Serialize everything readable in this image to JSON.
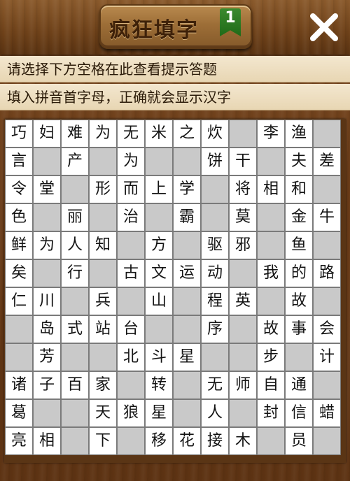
{
  "header": {
    "title": "疯狂填字",
    "level": "1"
  },
  "hints": {
    "line1": "请选择下方空格在此查看提示答题",
    "line2": "填入拼音首字母，正确就会显示汉字"
  },
  "close_icon": "close-icon",
  "grid": {
    "rows": [
      [
        "巧",
        "妇",
        "难",
        "为",
        "无",
        "米",
        "之",
        "炊",
        null,
        "李",
        "渔",
        null
      ],
      [
        "言",
        "",
        "产",
        "",
        "为",
        "",
        "",
        "饼",
        "干",
        "",
        "夫",
        "差"
      ],
      [
        "令",
        "堂",
        "",
        "形",
        "而",
        "上",
        "学",
        "",
        "将",
        "相",
        "和",
        ""
      ],
      [
        "色",
        "",
        "丽",
        "",
        "治",
        "",
        "霸",
        "",
        "莫",
        "",
        "金",
        "牛"
      ],
      [
        "鲜",
        "为",
        "人",
        "知",
        "",
        "方",
        "",
        "驱",
        "邪",
        "",
        "鱼",
        ""
      ],
      [
        "矣",
        "",
        "行",
        "",
        "古",
        "文",
        "运",
        "动",
        "",
        "我",
        "的",
        "路"
      ],
      [
        "仁",
        "川",
        "",
        "兵",
        "",
        "山",
        "",
        "程",
        "英",
        "",
        "故",
        ""
      ],
      [
        null,
        "岛",
        "式",
        "站",
        "台",
        "",
        "",
        "序",
        "",
        "故",
        "事",
        "会"
      ],
      [
        null,
        "芳",
        "",
        "",
        "北",
        "斗",
        "星",
        "",
        "",
        "步",
        "",
        "计"
      ],
      [
        "诸",
        "子",
        "百",
        "家",
        "",
        "转",
        "",
        "无",
        "师",
        "自",
        "通",
        ""
      ],
      [
        "葛",
        "",
        "",
        "天",
        "狼",
        "星",
        "",
        "人",
        "",
        "封",
        "信",
        "蜡"
      ],
      [
        "亮",
        "相",
        "",
        "下",
        "",
        "移",
        "花",
        "接",
        "木",
        "",
        "员",
        ""
      ]
    ],
    "cell_types": [
      [
        "w",
        "w",
        "w",
        "w",
        "w",
        "w",
        "w",
        "w",
        "g",
        "w",
        "w",
        "g"
      ],
      [
        "w",
        "g",
        "w",
        "g",
        "w",
        "g",
        "g",
        "w",
        "w",
        "g",
        "w",
        "w"
      ],
      [
        "w",
        "w",
        "g",
        "w",
        "w",
        "w",
        "w",
        "g",
        "w",
        "w",
        "w",
        "g"
      ],
      [
        "w",
        "g",
        "w",
        "g",
        "w",
        "g",
        "w",
        "g",
        "w",
        "g",
        "w",
        "w"
      ],
      [
        "w",
        "w",
        "w",
        "w",
        "g",
        "w",
        "g",
        "w",
        "w",
        "g",
        "w",
        "g"
      ],
      [
        "w",
        "g",
        "w",
        "g",
        "w",
        "w",
        "w",
        "w",
        "g",
        "w",
        "w",
        "w"
      ],
      [
        "w",
        "w",
        "g",
        "w",
        "g",
        "w",
        "g",
        "w",
        "w",
        "g",
        "w",
        "g"
      ],
      [
        "g",
        "w",
        "w",
        "w",
        "w",
        "g",
        "g",
        "w",
        "g",
        "w",
        "w",
        "w"
      ],
      [
        "g",
        "w",
        "g",
        "g",
        "w",
        "w",
        "w",
        "g",
        "g",
        "w",
        "g",
        "w"
      ],
      [
        "w",
        "w",
        "w",
        "w",
        "g",
        "w",
        "g",
        "w",
        "w",
        "w",
        "w",
        "g"
      ],
      [
        "w",
        "g",
        "g",
        "w",
        "w",
        "w",
        "g",
        "w",
        "g",
        "w",
        "w",
        "w"
      ],
      [
        "w",
        "w",
        "g",
        "w",
        "g",
        "w",
        "w",
        "w",
        "w",
        "g",
        "w",
        "g"
      ]
    ]
  },
  "colors": {
    "header_wood": "#6e4119",
    "plaque": "#9d6e37",
    "title_text": "#3e2109",
    "badge_green": "#2a7a22",
    "hint_bg": "#efe1c4",
    "cell_white": "#ffffff",
    "cell_gray": "#c9c9c9",
    "cell_text": "#141414"
  }
}
